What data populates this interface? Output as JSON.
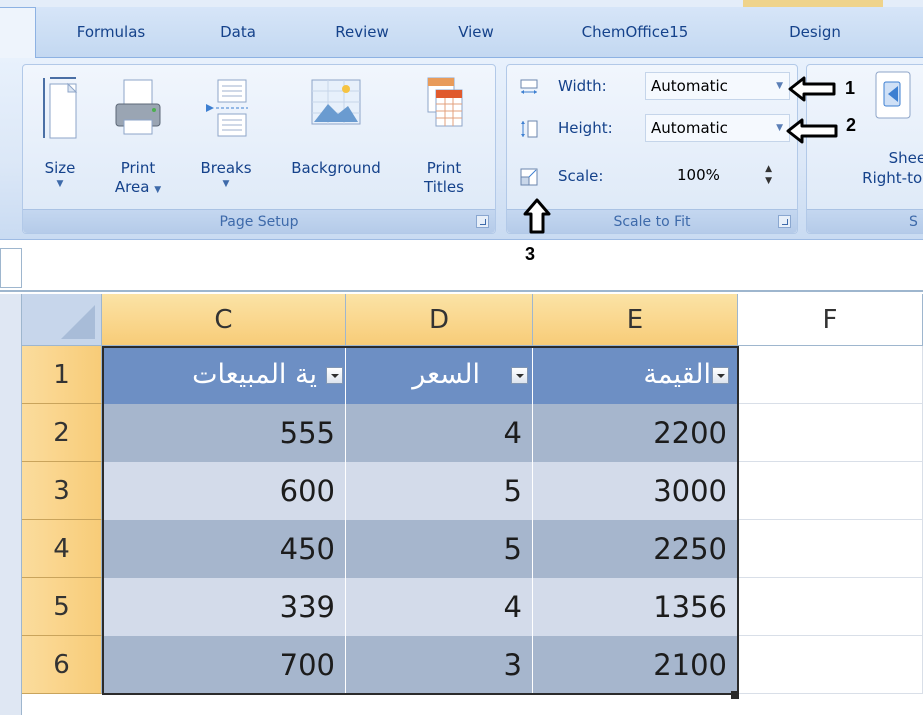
{
  "tabs": [
    "Formulas",
    "Data",
    "Review",
    "View",
    "ChemOffice15",
    "Design"
  ],
  "page_setup": {
    "group_label": "Page Setup",
    "buttons": [
      {
        "label": "Size",
        "dropdown": true
      },
      {
        "label": "Print",
        "label2": "Area",
        "dropdown": true
      },
      {
        "label": "Breaks",
        "dropdown": true
      },
      {
        "label": "Background",
        "dropdown": false
      },
      {
        "label": "Print",
        "label2": "Titles",
        "dropdown": false
      }
    ]
  },
  "scale_to_fit": {
    "group_label": "Scale to Fit",
    "width_label": "Width:",
    "width_value": "Automatic",
    "height_label": "Height:",
    "height_value": "Automatic",
    "scale_label": "Scale:",
    "scale_value": "100%"
  },
  "sheet_options": {
    "label1": "Sheet",
    "label2": "Right-to-l",
    "group_label_fragment": "S"
  },
  "callouts": [
    "1",
    "2",
    "3"
  ],
  "columns": [
    "C",
    "D",
    "E",
    "F"
  ],
  "rows": [
    "1",
    "2",
    "3",
    "4",
    "5",
    "6"
  ],
  "table": {
    "headers": [
      "ية المبيعات",
      "السعر",
      "القيمة"
    ],
    "data": [
      [
        "555",
        "4",
        "2200"
      ],
      [
        "600",
        "5",
        "3000"
      ],
      [
        "450",
        "5",
        "2250"
      ],
      [
        "339",
        "4",
        "1356"
      ],
      [
        "700",
        "3",
        "2100"
      ]
    ]
  },
  "colors": {
    "table_header": "#6d8fc4",
    "band_dark": "#a6b6cd",
    "band_light": "#d3dbea",
    "header_highlight": "#f8cc78"
  }
}
